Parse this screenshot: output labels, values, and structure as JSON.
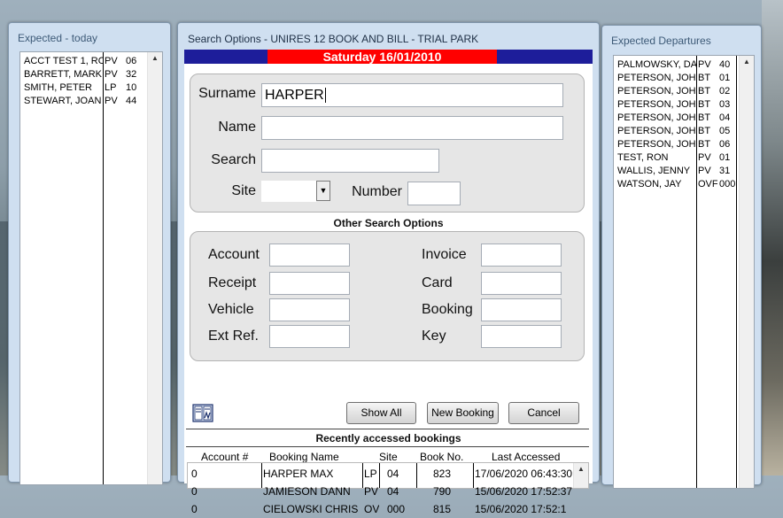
{
  "expected_today": {
    "title": "Expected - today",
    "rows": [
      {
        "name": "ACCT TEST 1, RO",
        "type": "PV",
        "num": "06"
      },
      {
        "name": "BARRETT, MARK",
        "type": "PV",
        "num": "32"
      },
      {
        "name": "SMITH, PETER",
        "type": "LP",
        "num": "10"
      },
      {
        "name": "STEWART, JOAN",
        "type": "PV",
        "num": "44"
      }
    ]
  },
  "search_dialog": {
    "title": "Search Options - UNIRES 12  BOOK AND BILL - TRIAL PARK",
    "date": "Saturday 16/01/2010",
    "surname_label": "Surname",
    "surname_value": "HARPER",
    "name_label": "Name",
    "name_value": "",
    "search_label": "Search",
    "search_value": "",
    "site_label": "Site",
    "site_value": "",
    "number_label": "Number",
    "number_value": "",
    "other_title": "Other Search Options",
    "account_label": "Account",
    "receipt_label": "Receipt",
    "vehicle_label": "Vehicle",
    "extref_label": "Ext Ref.",
    "invoice_label": "Invoice",
    "card_label": "Card",
    "booking_label": "Booking",
    "key_label": "Key",
    "show_all": "Show All",
    "new_booking": "New Booking",
    "cancel": "Cancel",
    "recent_title": "Recently accessed bookings",
    "recent_headers": {
      "account": "Account #",
      "name": "Booking Name",
      "site": "Site",
      "bookno": "Book No.",
      "last": "Last Accessed"
    },
    "recent_rows": [
      {
        "account": "0",
        "name": "HARPER MAX",
        "site_type": "LP",
        "site_num": "04",
        "bookno": "823",
        "last": "17/06/2020 06:43:30"
      },
      {
        "account": "0",
        "name": "JAMIESON DANN",
        "site_type": "PV",
        "site_num": "04",
        "bookno": "790",
        "last": "15/06/2020 17:52:37"
      },
      {
        "account": "0",
        "name": "CIELOWSKI CHRIS",
        "site_type": "OVF",
        "site_num": "000",
        "bookno": "815",
        "last": "15/06/2020 17:52:1"
      }
    ]
  },
  "expected_departures": {
    "title": "Expected Departures",
    "rows": [
      {
        "name": "PALMOWSKY, DA",
        "type": "PV",
        "num": "40"
      },
      {
        "name": "PETERSON, JOHN",
        "type": "BT",
        "num": "01"
      },
      {
        "name": "PETERSON, JOHN",
        "type": "BT",
        "num": "02"
      },
      {
        "name": "PETERSON, JOHN",
        "type": "BT",
        "num": "03"
      },
      {
        "name": "PETERSON, JOHN",
        "type": "BT",
        "num": "04"
      },
      {
        "name": "PETERSON, JOHN",
        "type": "BT",
        "num": "05"
      },
      {
        "name": "PETERSON, JOHN",
        "type": "BT",
        "num": "06"
      },
      {
        "name": "TEST, RON",
        "type": "PV",
        "num": "01"
      },
      {
        "name": "WALLIS, JENNY",
        "type": "PV",
        "num": "31"
      },
      {
        "name": "WATSON, JAY",
        "type": "OVF",
        "num": "000"
      }
    ]
  }
}
